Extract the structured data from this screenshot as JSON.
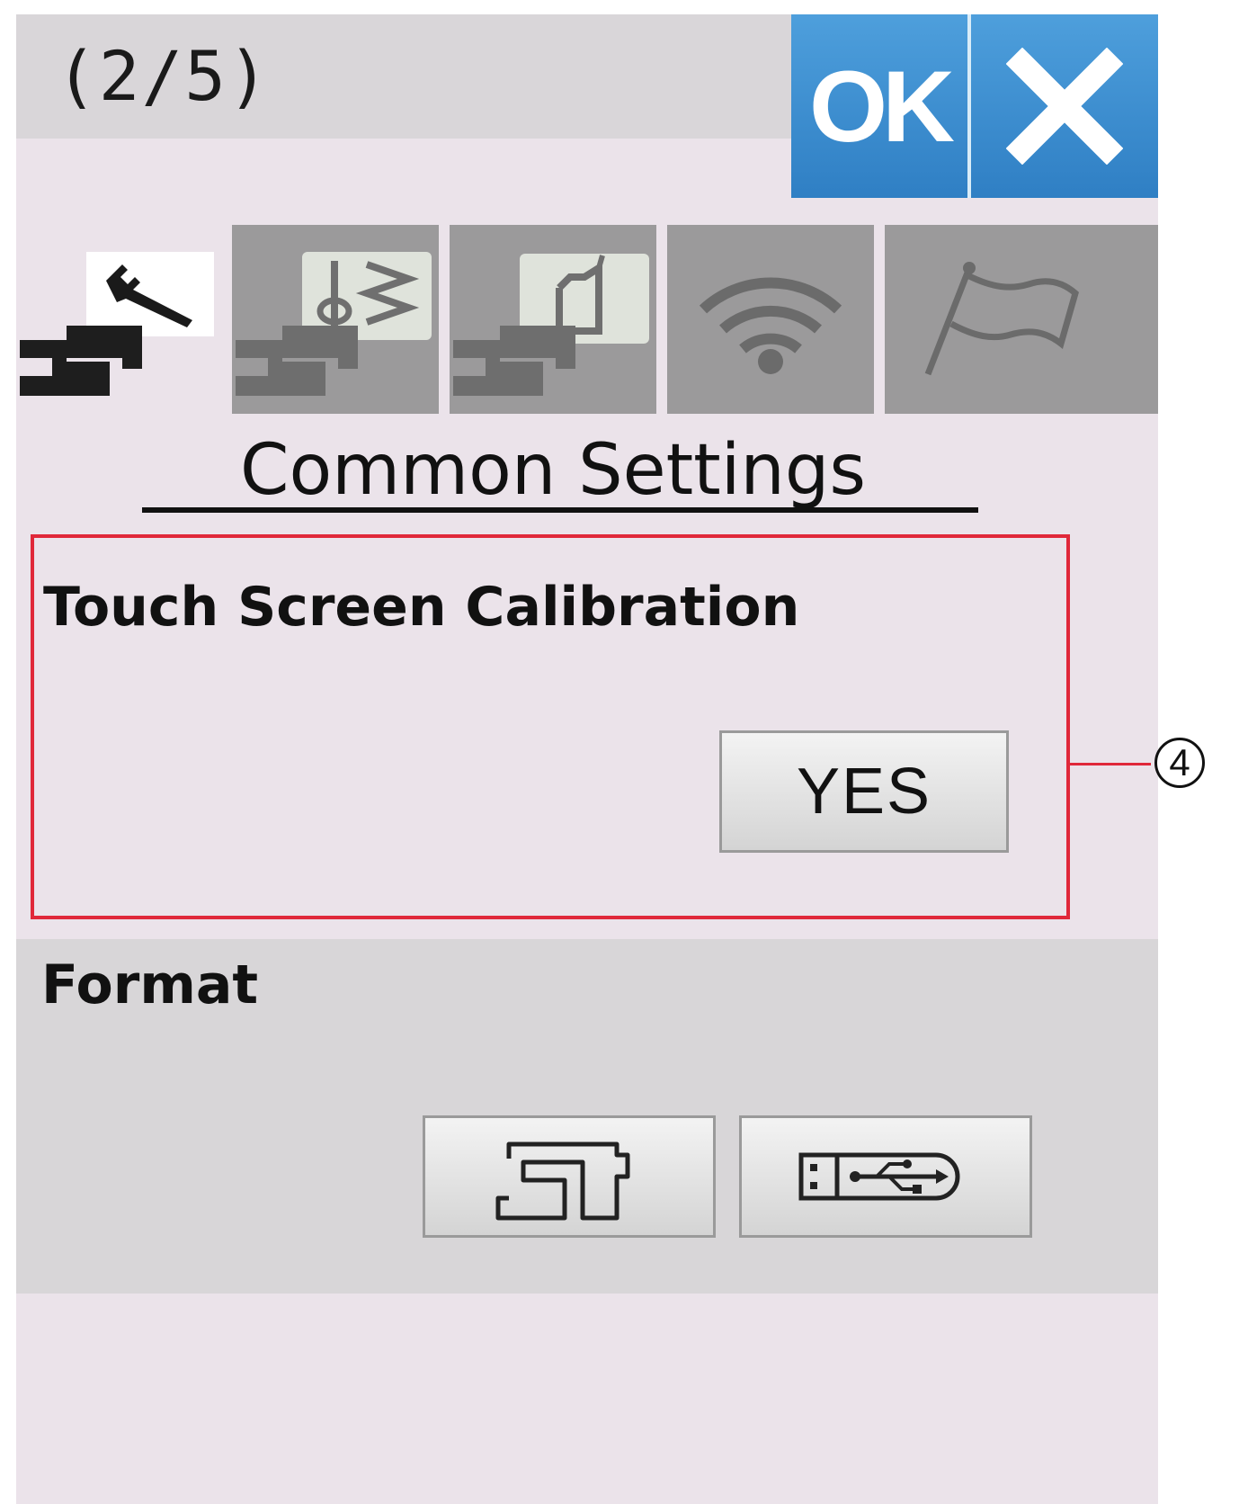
{
  "header": {
    "page_indicator": "(2/5)",
    "ok_label": "OK",
    "close_icon": "close-icon"
  },
  "tabs": [
    {
      "name": "common-settings",
      "icon": "sewing-machine-wrench-icon",
      "active": true
    },
    {
      "name": "sewing-settings",
      "icon": "sewing-machine-stitch-icon",
      "active": false
    },
    {
      "name": "embroidery-settings",
      "icon": "sewing-machine-hoop-icon",
      "active": false
    },
    {
      "name": "wireless-settings",
      "icon": "wifi-icon",
      "active": false
    },
    {
      "name": "language-settings",
      "icon": "flag-icon",
      "active": false
    }
  ],
  "main": {
    "section_title": "Common Settings",
    "calibration": {
      "label": "Touch Screen Calibration",
      "button_label": "YES",
      "callout_number": "4"
    },
    "format": {
      "label": "Format",
      "buttons": [
        {
          "name": "format-machine-memory",
          "icon": "sewing-machine-outline-icon"
        },
        {
          "name": "format-usb",
          "icon": "usb-icon"
        }
      ]
    }
  },
  "colors": {
    "accent_blue": "#3a8ed2",
    "callout_red": "#e0283a",
    "screen_bg": "#ebe3ea",
    "tab_inactive": "#9b9a9b",
    "panel_gray": "#d8d6d8"
  }
}
